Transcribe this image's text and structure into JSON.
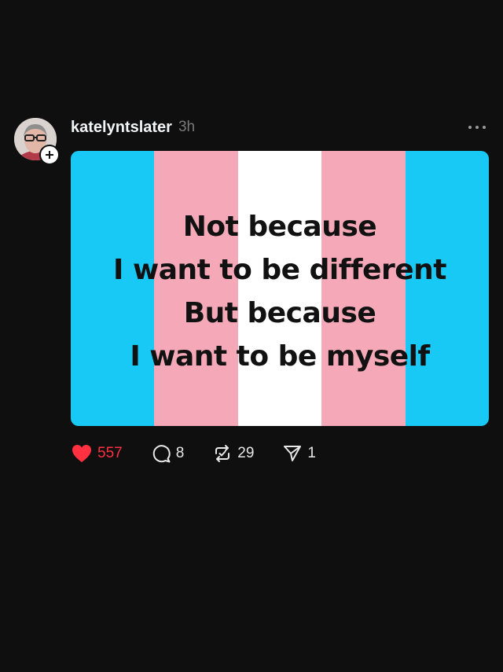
{
  "post": {
    "username": "katelyntslater",
    "timestamp": "3h",
    "avatar_icon": "profile-photo",
    "follow_icon": "plus-icon",
    "more_icon": "more-horizontal-icon",
    "media": {
      "stripes": [
        "#18c9f5",
        "#f5a9b8",
        "#ffffff",
        "#f5a9b8",
        "#18c9f5"
      ],
      "lines": [
        "Not because",
        "I want to be different",
        "But because",
        "I want to be myself"
      ]
    },
    "actions": {
      "like": {
        "icon": "heart-filled-icon",
        "count": "557",
        "color": "#ff3040"
      },
      "comment": {
        "icon": "comment-icon",
        "count": "8"
      },
      "repost": {
        "icon": "repost-icon",
        "count": "29"
      },
      "share": {
        "icon": "send-icon",
        "count": "1"
      }
    }
  }
}
